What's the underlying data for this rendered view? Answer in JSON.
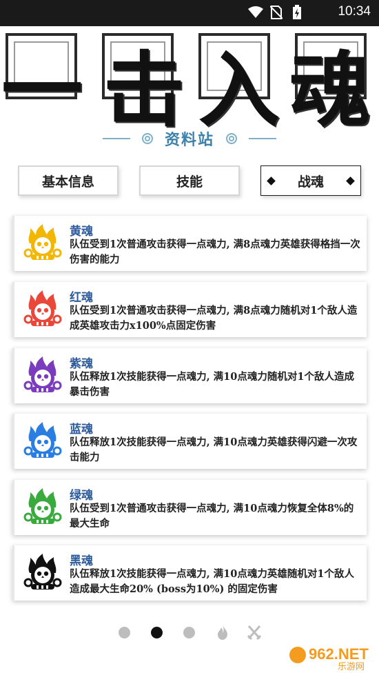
{
  "status_bar": {
    "time": "10:34"
  },
  "banner": {
    "title_chars": [
      "一",
      "击",
      "入",
      "魂"
    ],
    "subtitle": "资料站"
  },
  "tabs": [
    {
      "label": "基本信息",
      "active": false
    },
    {
      "label": "技能",
      "active": false
    },
    {
      "label": "战魂",
      "active": true
    }
  ],
  "souls": [
    {
      "name": "黄魂",
      "color": "#f2b705",
      "description": "队伍受到1次普通攻击获得一点魂力, 满8点魂力英雄获得格挡一次伤害的能力"
    },
    {
      "name": "红魂",
      "color": "#e8473a",
      "description": "队伍受到1次普通攻击获得一点魂力, 满8点魂力随机对1个敌人造成英雄攻击力x100%点固定伤害"
    },
    {
      "name": "紫魂",
      "color": "#7a3bbd",
      "description": "队伍释放1次技能获得一点魂力, 满10点魂力随机对1个敌人造成暴击伤害"
    },
    {
      "name": "蓝魂",
      "color": "#2a7de1",
      "description": "队伍释放1次技能获得一点魂力, 满10点魂力英雄获得闪避一次攻击能力"
    },
    {
      "name": "绿魂",
      "color": "#3aaa3f",
      "description": "队伍受到1次普通攻击获得一点魂力, 满10点魂力恢复全体8%的最大生命"
    },
    {
      "name": "黑魂",
      "color": "#111111",
      "description": "队伍释放1次技能获得一点魂力, 满10点魂力英雄随机对1个敌人造成最大生命20% (boss为10%) 的固定伤害"
    }
  ],
  "pager": {
    "pages": 3,
    "current_page": 2,
    "icons": [
      "flame-icon",
      "crossed-swords-icon"
    ]
  },
  "watermark": {
    "text": "962.NET",
    "subtext": "乐游网"
  }
}
